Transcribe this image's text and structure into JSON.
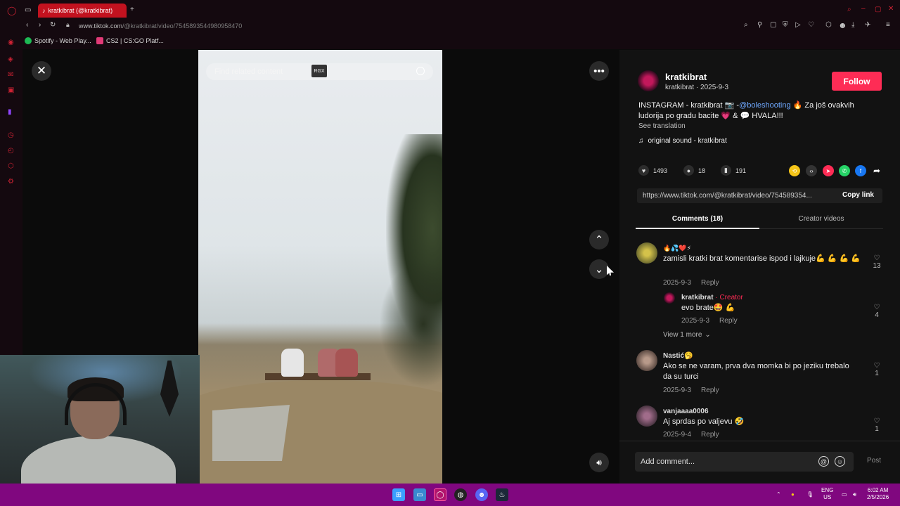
{
  "browser": {
    "tab_title": "kratkibrat (@kratkibrat)",
    "url_host": "www.tiktok.com",
    "url_path": "/@kratkibrat/video/7545893544980958470",
    "bookmarks": [
      {
        "label": "Spotify - Web Play...",
        "color": "#1db954"
      },
      {
        "label": "CS2 | CS:GO Platf...",
        "color": "#e23a77"
      }
    ]
  },
  "video": {
    "search_placeholder": "Find related content",
    "search_badge": "RGX"
  },
  "author": {
    "name": "kratkibrat",
    "sub": "kratkibrat · 2025-9-3",
    "follow_label": "Follow"
  },
  "post": {
    "desc_prefix": "INSTAGRAM - kratkibrat 📷 -",
    "desc_mention": "@boleshooting",
    "desc_suffix": " 🔥 Za još ovakvih ludorija po gradu bacite 💗 & 💬 HVALA!!!",
    "see_translation": "See translation",
    "sound": "original sound - kratkibrat",
    "likes": "1493",
    "comments": "18",
    "saves": "191",
    "link": "https://www.tiktok.com/@kratkibrat/video/754589354...",
    "copy_link": "Copy link"
  },
  "tabs": {
    "comments": "Comments (18)",
    "creator_videos": "Creator videos"
  },
  "comments": [
    {
      "emoji_row": "🔥💦❤️⚡",
      "text": "zamisli kratki brat komentarise ispod i lajkuje💪 💪 💪 💪",
      "date": "2025-9-3",
      "reply": "Reply",
      "likes": "13"
    },
    {
      "name": "kratkibrat",
      "creator": " · Creator",
      "text": "evo brate🤩 💪",
      "date": "2025-9-3",
      "reply": "Reply",
      "likes": "4"
    },
    {
      "name": "Nastić🥱",
      "text": "Ako se ne varam, prva dva momka bi po jeziku trebalo da su turci",
      "date": "2025-9-3",
      "reply": "Reply",
      "likes": "1"
    },
    {
      "name": "vanjaaaa0006",
      "text": "Aj sprdas po valjevu 🤣",
      "date": "2025-9-4",
      "reply": "Reply",
      "likes": "1"
    }
  ],
  "view_more": "View 1 more",
  "composer": {
    "placeholder": "Add comment...",
    "post_label": "Post"
  },
  "system": {
    "lang1": "ENG",
    "lang2": "US",
    "time": "6:02 AM",
    "date": "2/5/2026"
  },
  "icons": [
    "opera-logo-icon",
    "close-icon",
    "more-icon",
    "chevron-up-icon",
    "chevron-down-icon",
    "volume-icon",
    "heart-icon",
    "comment-icon",
    "bookmark-icon",
    "share-icon",
    "search-icon",
    "mention-icon",
    "emoji-icon"
  ]
}
